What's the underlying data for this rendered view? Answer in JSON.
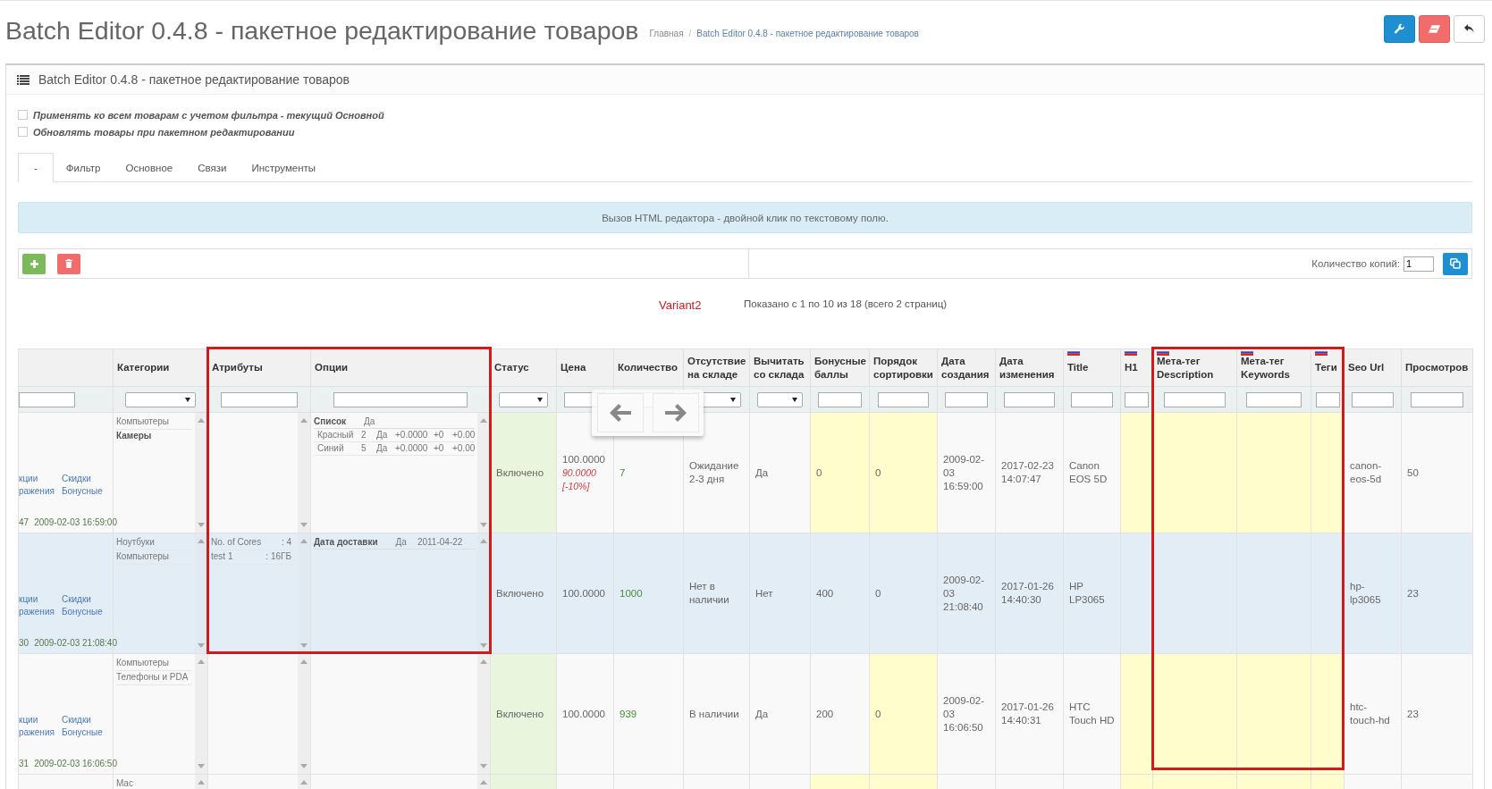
{
  "header": {
    "title": "Batch Editor 0.4.8 - пакетное редактирование товаров",
    "breadcrumb": {
      "separator": "/",
      "items": [
        "Главная",
        "Batch Editor 0.4.8 - пакетное редактирование товаров"
      ]
    },
    "buttons": [
      {
        "kind": "settings"
      },
      {
        "kind": "clear"
      },
      {
        "kind": "back"
      }
    ]
  },
  "panel": {
    "title": "Batch Editor 0.4.8 - пакетное редактирование товаров",
    "options": [
      {
        "label": "Применять ко всем товарам с учетом фильтра - текущий Основной",
        "checked": false
      },
      {
        "label": "Обновлять товары при пакетном редактировании",
        "checked": false
      }
    ],
    "tabs": [
      {
        "label": "-",
        "selected": true
      },
      {
        "label": "Фильтр",
        "selected": false
      },
      {
        "label": "Основное",
        "selected": false
      },
      {
        "label": "Связи",
        "selected": false
      },
      {
        "label": "Инструменты",
        "selected": false
      }
    ],
    "notice": "Вызов HTML редактора - двойной клик по текстовому полю.",
    "toolbar": {
      "buttons": [
        {
          "kind": "add"
        },
        {
          "kind": "delete"
        }
      ],
      "copies_label": "Количество копий:",
      "copies_value": "1",
      "copy_button": {
        "kind": "copy"
      }
    },
    "variant": "Variant2",
    "pagination": "Показано с 1 по 10 из 18 (всего 2 страниц)"
  },
  "table": {
    "columns": [
      {
        "kind": "links",
        "filter_dropdown": false
      },
      {
        "kind": "list",
        "label": "Категории",
        "filter_dropdown": true
      },
      {
        "kind": "attributes",
        "label": "Атрибуты",
        "filter_dropdown": false
      },
      {
        "kind": "options",
        "label": "Опции",
        "filter_dropdown": false
      },
      {
        "kind": "status",
        "label": "Статус",
        "filter_dropdown": true
      },
      {
        "kind": "price",
        "label": "Цена",
        "filter_dropdown": false
      },
      {
        "kind": "qty",
        "label": "Количество"
      },
      {
        "kind": "text",
        "label": "Отсутствие на складе",
        "filter_dropdown": true
      },
      {
        "kind": "text",
        "label": "Вычитать со склада",
        "filter_dropdown": true
      },
      {
        "kind": "marked",
        "label": "Бонусные баллы",
        "filter_dropdown": false
      },
      {
        "kind": "marked",
        "label": "Порядок сортировки",
        "filter_dropdown": false
      },
      {
        "kind": "text",
        "label": "Дата создания",
        "filter_dropdown": false
      },
      {
        "kind": "text",
        "label": "Дата изменения",
        "filter_dropdown": false
      },
      {
        "kind": "text",
        "label": "Title",
        "filter_dropdown": false,
        "flag": true
      },
      {
        "kind": "marked",
        "label": "H1",
        "filter_dropdown": false,
        "flag": true
      },
      {
        "kind": "marked",
        "label": "Мета-тег Description",
        "filter_dropdown": false,
        "flag": true
      },
      {
        "kind": "marked",
        "label": "Мета-тег Keywords",
        "filter_dropdown": false,
        "flag": true
      },
      {
        "kind": "marked",
        "label": "Теги",
        "filter_dropdown": false,
        "flag": true
      },
      {
        "kind": "text",
        "label": "Seo Url",
        "filter_dropdown": false
      },
      {
        "kind": "text",
        "label": "Просмотров",
        "filter_dropdown": false
      }
    ],
    "rows": [
      {
        "selected": false,
        "cells": [
          {
            "links": [
              "кции",
              "Скидки",
              "ражения",
              "Бонусные"
            ],
            "id": "47",
            "date": "2009-02-03 16:59:00"
          },
          {
            "items": [
              {
                "text": "Компьютеры",
                "bold": false
              },
              {
                "text": "Камеры",
                "bold": true
              }
            ]
          },
          {},
          {
            "items": [
              {
                "name": "Список",
                "required": "Да",
                "values": [
                  [
                    "Красный",
                    "2",
                    "Да",
                    "+0.0000",
                    "+0",
                    "+0.00"
                  ],
                  [
                    "Синий",
                    "5",
                    "Да",
                    "+0.0000",
                    "+0",
                    "+0.00"
                  ]
                ]
              }
            ]
          },
          {
            "text": "Включено",
            "on": true
          },
          {
            "text": "100.0000",
            "special": "90.0000",
            "discount": "[-10%]"
          },
          {
            "text": "7"
          },
          {
            "text": "Ожидание 2-3 дня"
          },
          {
            "text": "Да"
          },
          {
            "text": "0",
            "marked": true
          },
          {
            "text": "0",
            "marked": true
          },
          {
            "text": "2009-02-03 16:59:00"
          },
          {
            "text": "2017-02-23 14:07:47"
          },
          {
            "text": "Canon EOS 5D"
          },
          {
            "marked": true
          },
          {
            "marked": true
          },
          {
            "marked": true
          },
          {
            "marked": true
          },
          {
            "text": "canon-eos-5d"
          },
          {
            "text": "50"
          }
        ]
      },
      {
        "selected": true,
        "cells": [
          {
            "links": [
              "кции",
              "Скидки",
              "ражения",
              "Бонусные"
            ],
            "id": "30",
            "date": "2009-02-03 21:08:40"
          },
          {
            "items": [
              {
                "text": "Ноутбуки",
                "bold": false
              },
              {
                "text": "Компьютеры",
                "bold": false
              }
            ]
          },
          {
            "items": [
              {
                "name": "No. of Cores",
                "value": ": 4"
              },
              {
                "name": "test 1",
                "value": ": 16ГБ"
              }
            ]
          },
          {
            "items": [
              {
                "name": "Дата доставки",
                "required": "Да",
                "value": "2011-04-22"
              }
            ]
          },
          {
            "text": "Включено"
          },
          {
            "text": "100.0000"
          },
          {
            "text": "1000"
          },
          {
            "text": "Нет в наличии"
          },
          {
            "text": "Нет"
          },
          {
            "text": "400"
          },
          {
            "text": "0"
          },
          {
            "text": "2009-02-03 21:08:40"
          },
          {
            "text": "2017-01-26 14:40:30"
          },
          {
            "text": "HP LP3065"
          },
          {},
          {},
          {},
          {},
          {
            "text": "hp-lp3065"
          },
          {
            "text": "23"
          }
        ]
      },
      {
        "selected": false,
        "cells": [
          {
            "links": [
              "кции",
              "Скидки",
              "ражения",
              "Бонусные"
            ],
            "id": "31",
            "date": "2009-02-03 16:06:50"
          },
          {
            "items": [
              {
                "text": "Компьютеры",
                "bold": false
              },
              {
                "text": "Телефоны и PDA",
                "bold": false
              }
            ]
          },
          {},
          {},
          {
            "text": "Включено",
            "on": true
          },
          {
            "text": "100.0000"
          },
          {
            "text": "939"
          },
          {
            "text": "В наличии"
          },
          {
            "text": "Да"
          },
          {
            "text": "200",
            "marked": false
          },
          {
            "text": "0",
            "marked": true
          },
          {
            "text": "2009-02-03 16:06:50"
          },
          {
            "text": "2017-01-26 14:40:31"
          },
          {
            "text": "HTC Touch HD"
          },
          {
            "marked": true
          },
          {
            "marked": true
          },
          {
            "marked": true
          },
          {
            "marked": true
          },
          {
            "text": "htc-touch-hd"
          },
          {
            "text": "23"
          }
        ]
      },
      {
        "selected": false,
        "cells": [
          {},
          {
            "items": [
              {
                "text": "Mac",
                "bold": false
              }
            ]
          },
          {},
          {},
          {
            "on": true
          },
          {},
          {},
          {},
          {},
          {
            "marked": true
          },
          {
            "marked": true
          },
          {},
          {},
          {},
          {
            "marked": true
          },
          {
            "marked": true
          },
          {
            "marked": true
          },
          {
            "marked": true
          },
          {},
          {}
        ]
      }
    ]
  }
}
